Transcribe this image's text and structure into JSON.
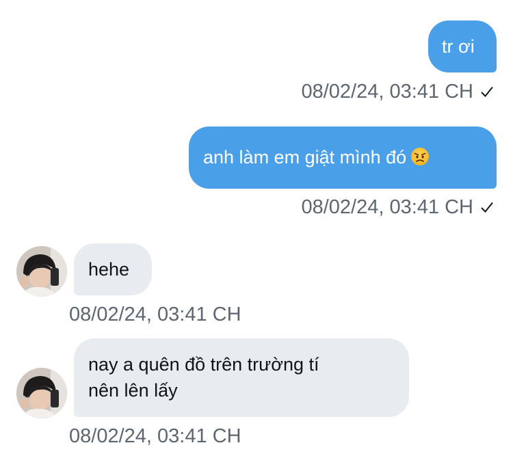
{
  "messages": [
    {
      "direction": "out",
      "text": "tr ơi",
      "timestamp": "08/02/24, 03:41 CH",
      "read_icon": "check-icon"
    },
    {
      "direction": "out",
      "text": "anh làm em giật mình đó",
      "emoji": "angry-face-emoji",
      "timestamp": "08/02/24, 03:41 CH",
      "read_icon": "check-icon"
    },
    {
      "direction": "in",
      "text": "hehe",
      "timestamp": "08/02/24, 03:41 CH",
      "avatar": "user-avatar"
    },
    {
      "direction": "in",
      "text_line1": "nay a quên đồ trên trường tí",
      "text_line2": "nên lên lấy",
      "timestamp": "08/02/24, 03:41 CH",
      "avatar": "user-avatar"
    }
  ],
  "colors": {
    "outgoing_bubble": "#4a9fe9",
    "incoming_bubble": "#e8ebef",
    "timestamp_text": "#5b6670"
  }
}
